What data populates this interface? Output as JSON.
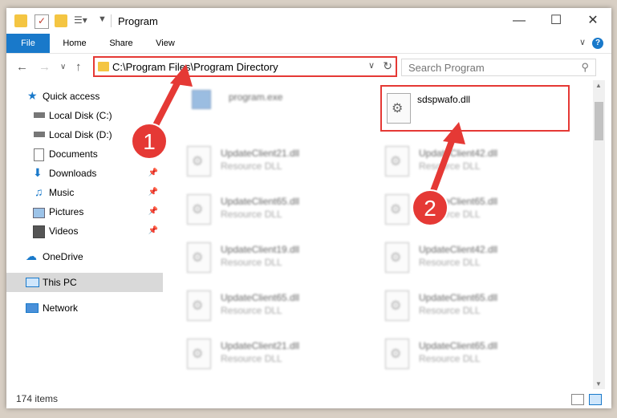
{
  "window": {
    "title": "Program",
    "controls": [
      "minimize",
      "maximize",
      "close"
    ]
  },
  "ribbon": {
    "tabs": [
      "File",
      "Home",
      "Share",
      "View"
    ],
    "help": "?"
  },
  "address_bar": {
    "path": "C:\\Program Files\\Program Directory"
  },
  "search": {
    "placeholder": "Search Program"
  },
  "sidebar": {
    "quick_access": "Quick access",
    "items": [
      {
        "label": "Local Disk (C:)",
        "icon": "drive-icon",
        "pinned": false
      },
      {
        "label": "Local Disk (D:)",
        "icon": "drive-icon",
        "pinned": false
      },
      {
        "label": "Documents",
        "icon": "documents-icon",
        "pinned": true
      },
      {
        "label": "Downloads",
        "icon": "downloads-icon",
        "pinned": true
      },
      {
        "label": "Music",
        "icon": "music-icon",
        "pinned": true
      },
      {
        "label": "Pictures",
        "icon": "pictures-icon",
        "pinned": true
      },
      {
        "label": "Videos",
        "icon": "videos-icon",
        "pinned": true
      }
    ],
    "onedrive": "OneDrive",
    "this_pc": "This PC",
    "network": "Network"
  },
  "files": {
    "exe": {
      "name": "program.exe"
    },
    "highlighted": {
      "name": "sdspwafo.dll"
    },
    "items": [
      {
        "name": "UpdateClient21.dll",
        "type": "Resource DLL"
      },
      {
        "name": "UpdateClient42.dll",
        "type": "Resource DLL"
      },
      {
        "name": "UpdateClient65.dll",
        "type": "Resource DLL"
      },
      {
        "name": "UpdateClient65.dll",
        "type": "Resource DLL"
      },
      {
        "name": "UpdateClient19.dll",
        "type": "Resource DLL"
      },
      {
        "name": "UpdateClient42.dll",
        "type": "Resource DLL"
      },
      {
        "name": "UpdateClient65.dll",
        "type": "Resource DLL"
      },
      {
        "name": "UpdateClient65.dll",
        "type": "Resource DLL"
      },
      {
        "name": "UpdateClient21.dll",
        "type": "Resource DLL"
      },
      {
        "name": "UpdateClient65.dll",
        "type": "Resource DLL"
      }
    ]
  },
  "status": {
    "item_count": "174 items"
  },
  "annotations": {
    "step1": "1",
    "step2": "2",
    "highlight_color": "#e53935"
  },
  "colors": {
    "accent": "#1979ca"
  }
}
